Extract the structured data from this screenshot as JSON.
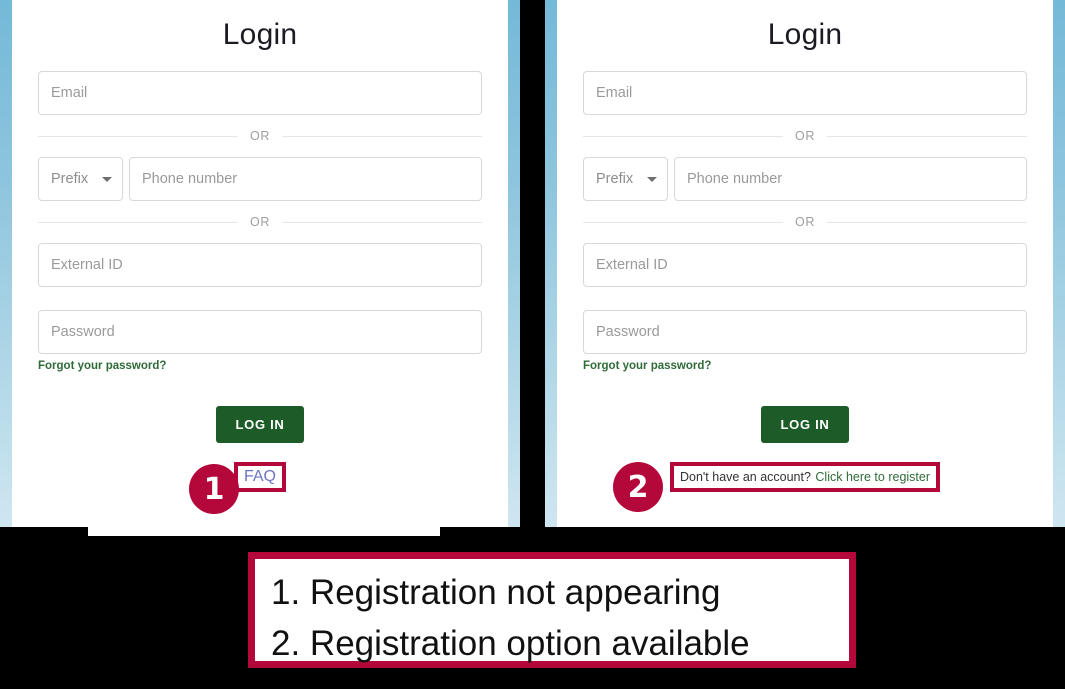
{
  "login_form": {
    "title": "Login",
    "email_placeholder": "Email",
    "or_label_1": "OR",
    "prefix_label": "Prefix",
    "phone_placeholder": "Phone number",
    "or_label_2": "OR",
    "external_id_placeholder": "External ID",
    "password_placeholder": "Password",
    "forgot_password_label": "Forgot your password?",
    "login_button_label": "LOG IN"
  },
  "left_panel": {
    "bottom_link_label": "FAQ",
    "badge_number": "1"
  },
  "right_panel": {
    "register_prompt": "Don't have an account?",
    "register_link_label": "Click here to register",
    "badge_number": "2"
  },
  "caption": {
    "line_1": "1. Registration not appearing",
    "line_2": "2. Registration option available"
  },
  "colors": {
    "annotation_crimson": "#b4083a",
    "login_button_green": "#1d5c28",
    "link_green": "#2f6b38",
    "faq_link_blue": "#6c74c8",
    "page_background": "#000000",
    "card_background": "#ffffff",
    "page_gradient_blue": "#74b9d8"
  }
}
